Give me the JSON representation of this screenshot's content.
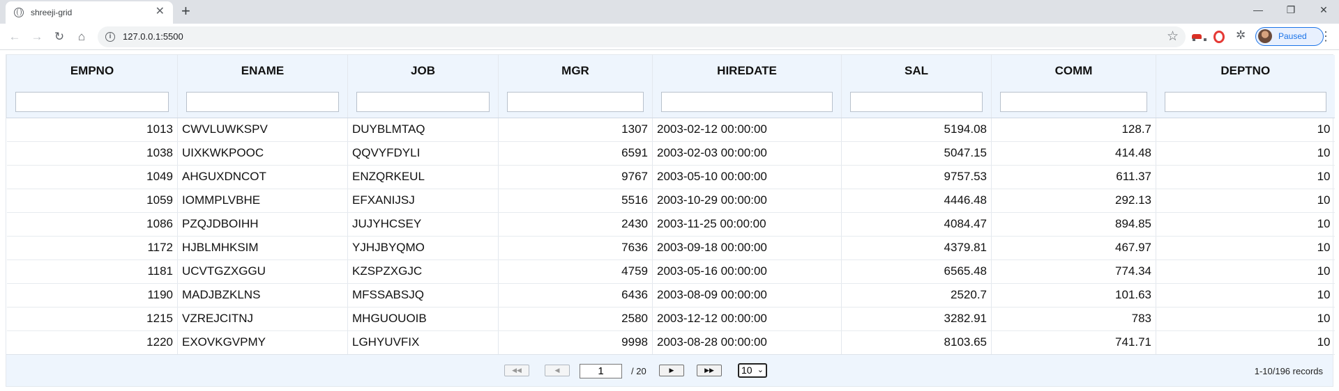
{
  "browser": {
    "tab_title": "shreeji-grid",
    "url": "127.0.0.1:5500",
    "profile_label": "Paused"
  },
  "grid": {
    "columns": [
      {
        "key": "empno",
        "label": "EMPNO",
        "align": "num"
      },
      {
        "key": "ename",
        "label": "ENAME",
        "align": "txt"
      },
      {
        "key": "job",
        "label": "JOB",
        "align": "txt"
      },
      {
        "key": "mgr",
        "label": "MGR",
        "align": "num"
      },
      {
        "key": "hiredate",
        "label": "HIREDATE",
        "align": "txt"
      },
      {
        "key": "sal",
        "label": "SAL",
        "align": "num"
      },
      {
        "key": "comm",
        "label": "COMM",
        "align": "num"
      },
      {
        "key": "deptno",
        "label": "DEPTNO",
        "align": "num"
      }
    ],
    "filters": [
      "",
      "",
      "",
      "",
      "",
      "",
      "",
      ""
    ],
    "rows": [
      [
        "1013",
        "CWVLUWKSPV",
        "DUYBLMTAQ",
        "1307",
        "2003-02-12 00:00:00",
        "5194.08",
        "128.7",
        "10"
      ],
      [
        "1038",
        "UIXKWKPOOC",
        "QQVYFDYLI",
        "6591",
        "2003-02-03 00:00:00",
        "5047.15",
        "414.48",
        "10"
      ],
      [
        "1049",
        "AHGUXDNCOT",
        "ENZQRKEUL",
        "9767",
        "2003-05-10 00:00:00",
        "9757.53",
        "611.37",
        "10"
      ],
      [
        "1059",
        "IOMMPLVBHE",
        "EFXANIJSJ",
        "5516",
        "2003-10-29 00:00:00",
        "4446.48",
        "292.13",
        "10"
      ],
      [
        "1086",
        "PZQJDBOIHH",
        "JUJYHCSEY",
        "2430",
        "2003-11-25 00:00:00",
        "4084.47",
        "894.85",
        "10"
      ],
      [
        "1172",
        "HJBLMHKSIM",
        "YJHJBYQMO",
        "7636",
        "2003-09-18 00:00:00",
        "4379.81",
        "467.97",
        "10"
      ],
      [
        "1181",
        "UCVTGZXGGU",
        "KZSPZXGJC",
        "4759",
        "2003-05-16 00:00:00",
        "6565.48",
        "774.34",
        "10"
      ],
      [
        "1190",
        "MADJBZKLNS",
        "MFSSABSJQ",
        "6436",
        "2003-08-09 00:00:00",
        "2520.7",
        "101.63",
        "10"
      ],
      [
        "1215",
        "VZREJCITNJ",
        "MHGUOUOIB",
        "2580",
        "2003-12-12 00:00:00",
        "3282.91",
        "783",
        "10"
      ],
      [
        "1220",
        "EXOVKGVPMY",
        "LGHYUVFIX",
        "9998",
        "2003-08-28 00:00:00",
        "8103.65",
        "741.71",
        "10"
      ]
    ]
  },
  "pager": {
    "first_icon": "double-left-triangle",
    "prev_icon": "left-triangle",
    "next_icon": "right-triangle",
    "last_icon": "double-right-triangle",
    "current_page": "1",
    "total_pages": "/ 20",
    "page_size": "10",
    "records": "1-10/196 records"
  }
}
